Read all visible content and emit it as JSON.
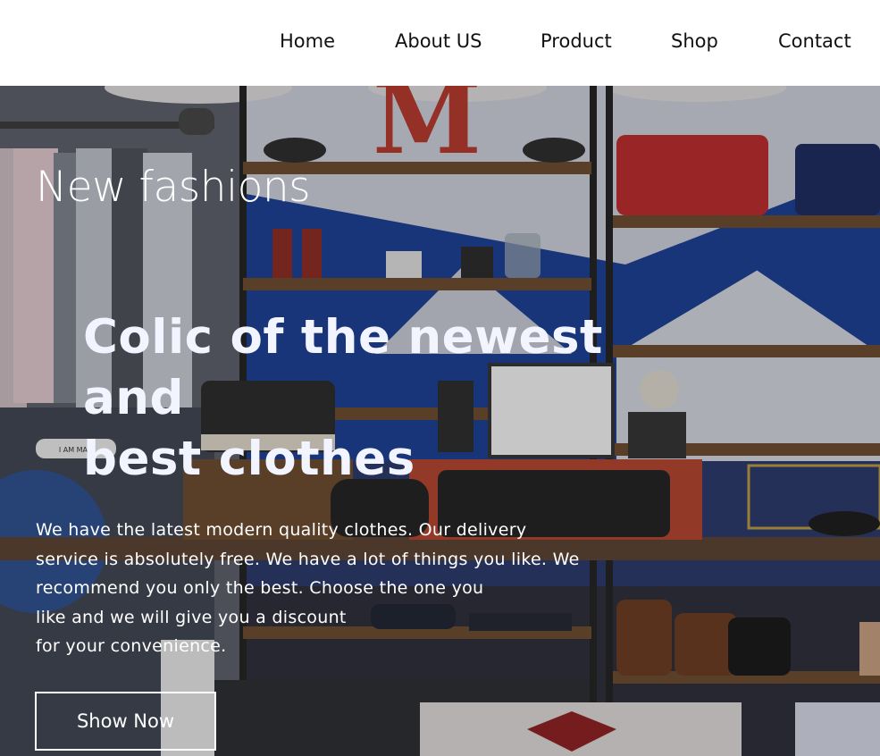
{
  "nav": {
    "items": [
      {
        "label": "Home"
      },
      {
        "label": "About US"
      },
      {
        "label": "Product"
      },
      {
        "label": "Shop"
      },
      {
        "label": "Contact"
      }
    ]
  },
  "hero": {
    "eyebrow": "New fashions",
    "headline_line1": "Colic of the newest and",
    "headline_line2": "best clothes",
    "description_lines": [
      "We have the latest modern quality clothes. Our delivery",
      "service is absolutely free. We have a lot of things you like. We",
      "recommend you only the best. Choose the one you",
      "like and we will give you a discount",
      "for your convenience."
    ],
    "cta_label": "Show Now",
    "background_description": "photo-of-clothing-store-shelves",
    "decor": {
      "sign": "M",
      "tag": "I AM MAD"
    }
  },
  "colors": {
    "nav_text": "#111111",
    "hero_text": "#ffffff",
    "headline_text": "#f2f4ff",
    "wall_blue": "#1b3a8a",
    "wall_white": "#d8d9e0"
  }
}
